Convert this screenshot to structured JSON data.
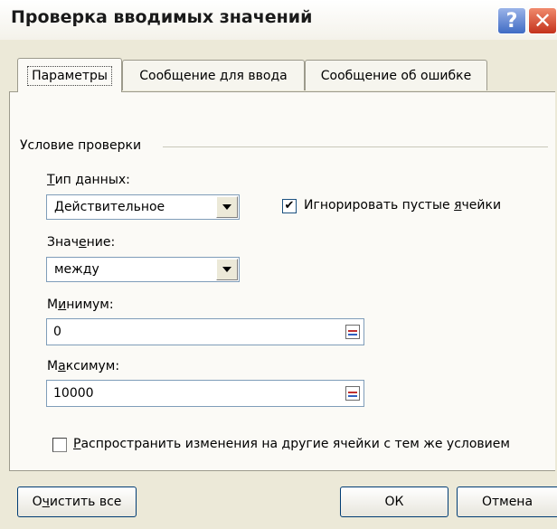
{
  "window": {
    "title": "Проверка вводимых значений"
  },
  "title_buttons": {
    "help": "?",
    "close": "✕"
  },
  "tabs": [
    {
      "label": "Параметры",
      "active": true
    },
    {
      "label": "Сообщение для ввода",
      "active": false
    },
    {
      "label": "Сообщение об ошибке",
      "active": false
    }
  ],
  "group": {
    "label": "Условие проверки"
  },
  "fields": {
    "data_type_label_pre": "Т",
    "data_type_label_post": "ип данных:",
    "data_type_value": "Действительное",
    "value_label_pre": "Знач",
    "value_label_u": "е",
    "value_label_post": "ние:",
    "value_value": "между",
    "min_label_pre": "М",
    "min_label_u": "и",
    "min_label_post": "нимум:",
    "min_value": "0",
    "max_label_pre": "М",
    "max_label_u": "а",
    "max_label_post": "ксимум:",
    "max_value": "10000"
  },
  "checkboxes": {
    "ignore_blank_pre": "Игнорировать пустые ",
    "ignore_blank_u": "я",
    "ignore_blank_post": "чейки",
    "ignore_blank_checked": true,
    "apply_all_u": "Р",
    "apply_all_post": "аспространить изменения на другие ячейки с тем же условием",
    "apply_all_checked": false
  },
  "buttons": {
    "clear_pre": "О",
    "clear_u": "ч",
    "clear_post": "истить все",
    "ok": "ОК",
    "cancel": "Отмена"
  }
}
